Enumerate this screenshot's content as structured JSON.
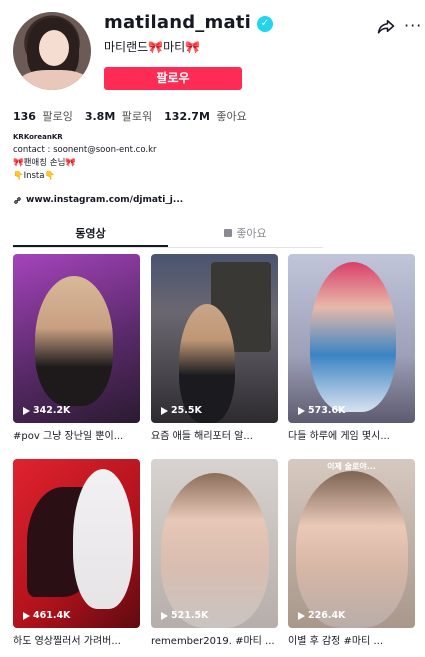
{
  "profile": {
    "username": "matiland_mati",
    "nickname": "마티랜드🎀마티🎀",
    "follow_label": "팔로우",
    "verified_icon": "verified-badge",
    "share_icon": "share-arrow-icon",
    "more_icon": "more-dots-icon"
  },
  "stats": {
    "following_count": "136",
    "following_label": "팔로잉",
    "followers_count": "3.8M",
    "followers_label": "팔로워",
    "likes_count": "132.7M",
    "likes_label": "좋아요"
  },
  "bio": {
    "line1": "KRKoreanKR",
    "line2": "contact : soonent@soon-ent.co.kr",
    "line3": "🎀팬애칭 손님🎀",
    "line4": "👇Insta👇"
  },
  "link": {
    "text": "www.instagram.com/djmati_j..."
  },
  "tabs": {
    "videos": "동영상",
    "liked": "좋아요"
  },
  "videos": [
    {
      "views": "342.2K",
      "caption": "#pov 그냥 장난일 뿐이...",
      "overlay": "",
      "colors": [
        "#9a3fae",
        "#3b1f46"
      ]
    },
    {
      "views": "25.5K",
      "caption": "요즘 애들 해리포터 알...",
      "overlay": "",
      "colors": [
        "#56607a",
        "#2a2a31"
      ]
    },
    {
      "views": "573.6K",
      "caption": "다들 하루에 게임 몇시...",
      "overlay": "",
      "colors": [
        "#b7bcd3",
        "#6e6b86"
      ]
    },
    {
      "views": "461.4K",
      "caption": "하도 영상찔러서 가려버...",
      "overlay": "",
      "colors": [
        "#d8212e",
        "#7a0c14"
      ]
    },
    {
      "views": "521.5K",
      "caption": "remember2019. #마티 ...",
      "overlay": "",
      "colors": [
        "#c9c4c2",
        "#8c8580"
      ]
    },
    {
      "views": "226.4K",
      "caption": "이별 후 감정 #마티 ...",
      "overlay": "이제 술로야...",
      "colors": [
        "#cfc0b8",
        "#8a7567"
      ]
    }
  ]
}
